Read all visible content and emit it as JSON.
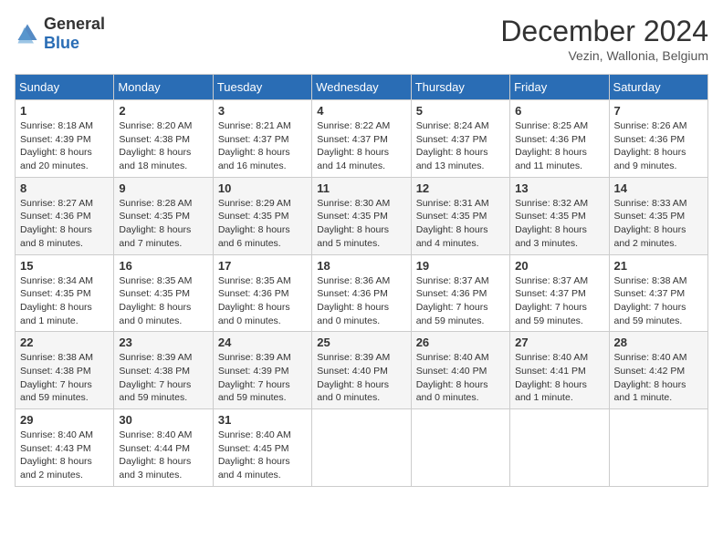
{
  "header": {
    "logo_general": "General",
    "logo_blue": "Blue",
    "month_title": "December 2024",
    "location": "Vezin, Wallonia, Belgium"
  },
  "days_of_week": [
    "Sunday",
    "Monday",
    "Tuesday",
    "Wednesday",
    "Thursday",
    "Friday",
    "Saturday"
  ],
  "weeks": [
    [
      {
        "day": "1",
        "sunrise": "8:18 AM",
        "sunset": "4:39 PM",
        "daylight": "8 hours and 20 minutes."
      },
      {
        "day": "2",
        "sunrise": "8:20 AM",
        "sunset": "4:38 PM",
        "daylight": "8 hours and 18 minutes."
      },
      {
        "day": "3",
        "sunrise": "8:21 AM",
        "sunset": "4:37 PM",
        "daylight": "8 hours and 16 minutes."
      },
      {
        "day": "4",
        "sunrise": "8:22 AM",
        "sunset": "4:37 PM",
        "daylight": "8 hours and 14 minutes."
      },
      {
        "day": "5",
        "sunrise": "8:24 AM",
        "sunset": "4:37 PM",
        "daylight": "8 hours and 13 minutes."
      },
      {
        "day": "6",
        "sunrise": "8:25 AM",
        "sunset": "4:36 PM",
        "daylight": "8 hours and 11 minutes."
      },
      {
        "day": "7",
        "sunrise": "8:26 AM",
        "sunset": "4:36 PM",
        "daylight": "8 hours and 9 minutes."
      }
    ],
    [
      {
        "day": "8",
        "sunrise": "8:27 AM",
        "sunset": "4:36 PM",
        "daylight": "8 hours and 8 minutes."
      },
      {
        "day": "9",
        "sunrise": "8:28 AM",
        "sunset": "4:35 PM",
        "daylight": "8 hours and 7 minutes."
      },
      {
        "day": "10",
        "sunrise": "8:29 AM",
        "sunset": "4:35 PM",
        "daylight": "8 hours and 6 minutes."
      },
      {
        "day": "11",
        "sunrise": "8:30 AM",
        "sunset": "4:35 PM",
        "daylight": "8 hours and 5 minutes."
      },
      {
        "day": "12",
        "sunrise": "8:31 AM",
        "sunset": "4:35 PM",
        "daylight": "8 hours and 4 minutes."
      },
      {
        "day": "13",
        "sunrise": "8:32 AM",
        "sunset": "4:35 PM",
        "daylight": "8 hours and 3 minutes."
      },
      {
        "day": "14",
        "sunrise": "8:33 AM",
        "sunset": "4:35 PM",
        "daylight": "8 hours and 2 minutes."
      }
    ],
    [
      {
        "day": "15",
        "sunrise": "8:34 AM",
        "sunset": "4:35 PM",
        "daylight": "8 hours and 1 minute."
      },
      {
        "day": "16",
        "sunrise": "8:35 AM",
        "sunset": "4:35 PM",
        "daylight": "8 hours and 0 minutes."
      },
      {
        "day": "17",
        "sunrise": "8:35 AM",
        "sunset": "4:36 PM",
        "daylight": "8 hours and 0 minutes."
      },
      {
        "day": "18",
        "sunrise": "8:36 AM",
        "sunset": "4:36 PM",
        "daylight": "8 hours and 0 minutes."
      },
      {
        "day": "19",
        "sunrise": "8:37 AM",
        "sunset": "4:36 PM",
        "daylight": "7 hours and 59 minutes."
      },
      {
        "day": "20",
        "sunrise": "8:37 AM",
        "sunset": "4:37 PM",
        "daylight": "7 hours and 59 minutes."
      },
      {
        "day": "21",
        "sunrise": "8:38 AM",
        "sunset": "4:37 PM",
        "daylight": "7 hours and 59 minutes."
      }
    ],
    [
      {
        "day": "22",
        "sunrise": "8:38 AM",
        "sunset": "4:38 PM",
        "daylight": "7 hours and 59 minutes."
      },
      {
        "day": "23",
        "sunrise": "8:39 AM",
        "sunset": "4:38 PM",
        "daylight": "7 hours and 59 minutes."
      },
      {
        "day": "24",
        "sunrise": "8:39 AM",
        "sunset": "4:39 PM",
        "daylight": "7 hours and 59 minutes."
      },
      {
        "day": "25",
        "sunrise": "8:39 AM",
        "sunset": "4:40 PM",
        "daylight": "8 hours and 0 minutes."
      },
      {
        "day": "26",
        "sunrise": "8:40 AM",
        "sunset": "4:40 PM",
        "daylight": "8 hours and 0 minutes."
      },
      {
        "day": "27",
        "sunrise": "8:40 AM",
        "sunset": "4:41 PM",
        "daylight": "8 hours and 1 minute."
      },
      {
        "day": "28",
        "sunrise": "8:40 AM",
        "sunset": "4:42 PM",
        "daylight": "8 hours and 1 minute."
      }
    ],
    [
      {
        "day": "29",
        "sunrise": "8:40 AM",
        "sunset": "4:43 PM",
        "daylight": "8 hours and 2 minutes."
      },
      {
        "day": "30",
        "sunrise": "8:40 AM",
        "sunset": "4:44 PM",
        "daylight": "8 hours and 3 minutes."
      },
      {
        "day": "31",
        "sunrise": "8:40 AM",
        "sunset": "4:45 PM",
        "daylight": "8 hours and 4 minutes."
      },
      null,
      null,
      null,
      null
    ]
  ]
}
